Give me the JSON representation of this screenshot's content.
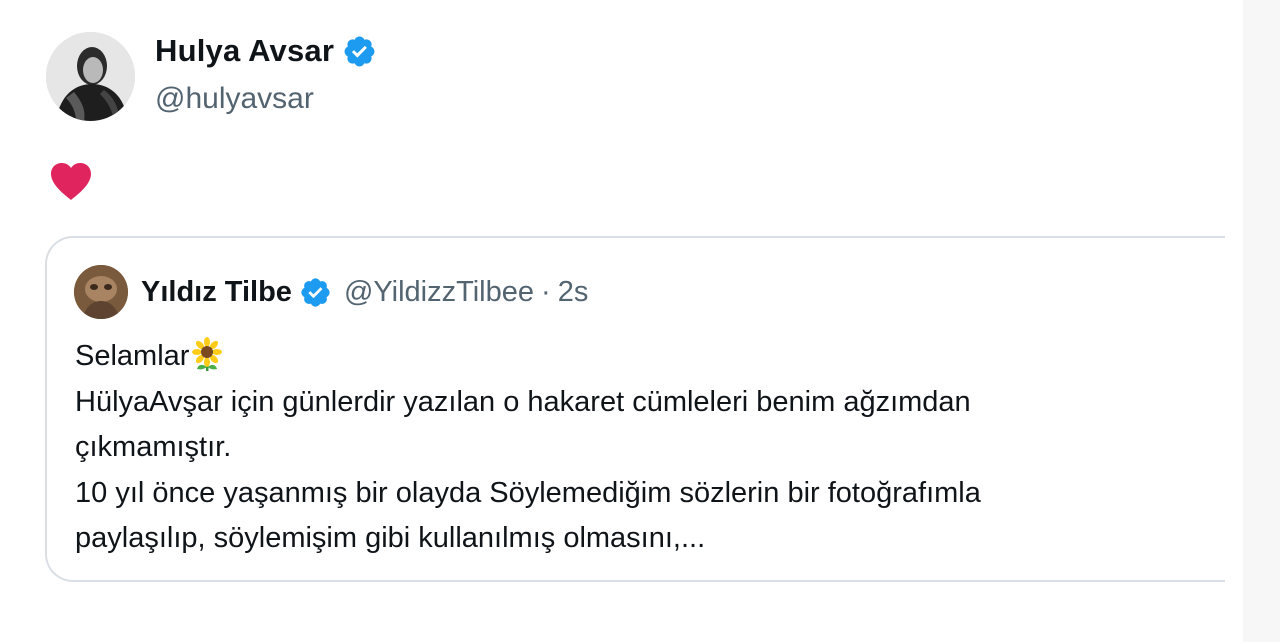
{
  "post": {
    "author": {
      "name": "Hulya Avsar",
      "handle": "@hulyavsar",
      "verified_icon": "verified-badge-icon",
      "avatar_icon": "profile-photo"
    },
    "text_icon": "red-heart-icon",
    "quote": {
      "author_name": "Yıldız Tilbe",
      "handle": "@YildizzTilbee",
      "separator": "·",
      "time": "2s",
      "verified_icon": "verified-badge-icon",
      "emoji_icon": "sunflower-icon",
      "lines": [
        "Selamlar",
        "HülyaAvşar için günlerdir yazılan o hakaret cümleleri benim ağzımdan",
        "çıkmamıştır.",
        "10 yıl önce yaşanmış bir olayda Söylemediğim sözlerin bir fotoğrafımla",
        "paylaşılıp, söylemişim gibi kullanılmış olmasını,..."
      ]
    }
  },
  "colors": {
    "text": "#0f1419",
    "secondary": "#536471",
    "verified_blue": "#1d9bf0",
    "heart_red": "#e0245e",
    "card_border": "#d9dfe4"
  }
}
